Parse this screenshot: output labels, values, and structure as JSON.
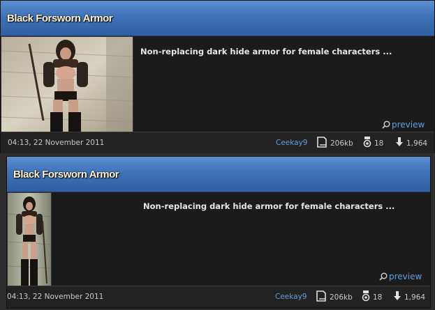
{
  "files": [
    {
      "title": "Black Forsworn Armor",
      "description": "Non-replacing dark hide armor for female characters ...",
      "preview_label": "preview",
      "date": "04:13, 22 November 2011",
      "author": "Ceekay9",
      "size": "206kb",
      "endorsements": "18",
      "downloads": "1,964",
      "thumbnail": "female character in dark hide armor"
    },
    {
      "title": "Black Forsworn Armor",
      "description": "Non-replacing dark hide armor for female characters ...",
      "preview_label": "preview",
      "date": "04:13, 22 November 2011",
      "author": "Ceekay9",
      "size": "206kb",
      "endorsements": "18",
      "downloads": "1,964",
      "thumbnail": "female character in dark hide armor"
    }
  ],
  "icons": {
    "preview": "magnifier-icon",
    "size": "file-icon",
    "endorsements": "medal-icon",
    "downloads": "download-arrow-icon"
  },
  "colors": {
    "header_blue": "#3e73b8",
    "link_blue": "#5fa0e3",
    "title_text": "#fff3d6"
  }
}
